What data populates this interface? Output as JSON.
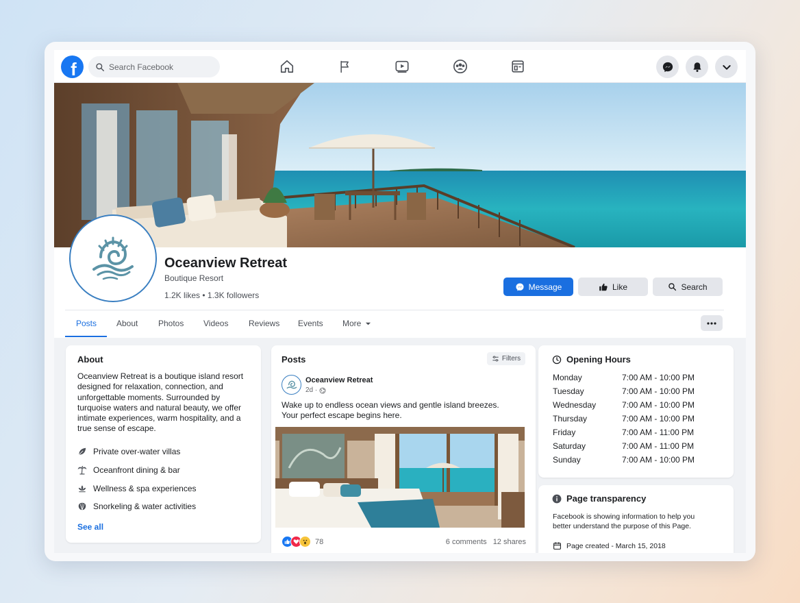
{
  "topbar": {
    "logo": "f",
    "search_placeholder": "Search Facebook",
    "nav_icons": [
      "home-icon",
      "flag-icon",
      "video-icon",
      "groups-icon",
      "marketplace-icon"
    ],
    "right_icons": [
      "messenger-icon",
      "bell-icon",
      "chevron-down-icon"
    ]
  },
  "page": {
    "name": "Oceanview Retreat",
    "category": "Boutique Resort",
    "stats": "1.2K likes • 1.3K followers"
  },
  "actions": {
    "message": "Message",
    "like": "Like",
    "search": "Search"
  },
  "tabs": [
    "Posts",
    "About",
    "Photos",
    "Videos",
    "Reviews",
    "Events",
    "More"
  ],
  "about": {
    "title": "About",
    "description": "Oceanview Retreat is a boutique island resort designed for relaxation, connection, and unforgettable moments. Surrounded by turquoise waters and natural beauty, we offer intimate experiences, warm hospitality, and a true sense of escape.",
    "features": [
      {
        "icon": "leaf-icon",
        "label": "Private over-water villas"
      },
      {
        "icon": "palm-tree-icon",
        "label": "Oceanfront dining & bar"
      },
      {
        "icon": "lotus-icon",
        "label": "Wellness & spa experiences"
      },
      {
        "icon": "shell-icon",
        "label": "Snorkeling & water activities"
      }
    ],
    "see_all": "See all"
  },
  "posts": {
    "title": "Posts",
    "filters": "Filters",
    "post": {
      "author": "Oceanview Retreat",
      "time": "2d ·",
      "text": "Wake up to endless ocean views and gentle island breezes. Your perfect escape begins here.",
      "reaction_count": "78",
      "comments": "6 comments",
      "shares": "12 shares"
    }
  },
  "hours": {
    "title": "Opening Hours",
    "days": [
      {
        "day": "Monday",
        "time": "7:00 AM - 10:00 PM"
      },
      {
        "day": "Tuesday",
        "time": "7:00 AM - 10:00 PM"
      },
      {
        "day": "Wednesday",
        "time": "7:00 AM - 10:00 PM"
      },
      {
        "day": "Thursday",
        "time": "7:00 AM - 10:00 PM"
      },
      {
        "day": "Friday",
        "time": "7:00 AM - 11:00 PM"
      },
      {
        "day": "Saturday",
        "time": "7:00 AM - 11:00 PM"
      },
      {
        "day": "Sunday",
        "time": "7:00 AM - 10:00 PM"
      }
    ]
  },
  "transparency": {
    "title": "Page transparency",
    "text": "Facebook is showing information to help you better understand the purpose of this Page.",
    "created": "Page created - March 15, 2018"
  },
  "colors": {
    "brand": "#1877f2",
    "primary_button": "#1a6fe0",
    "logo_teal": "#5b93a6"
  }
}
